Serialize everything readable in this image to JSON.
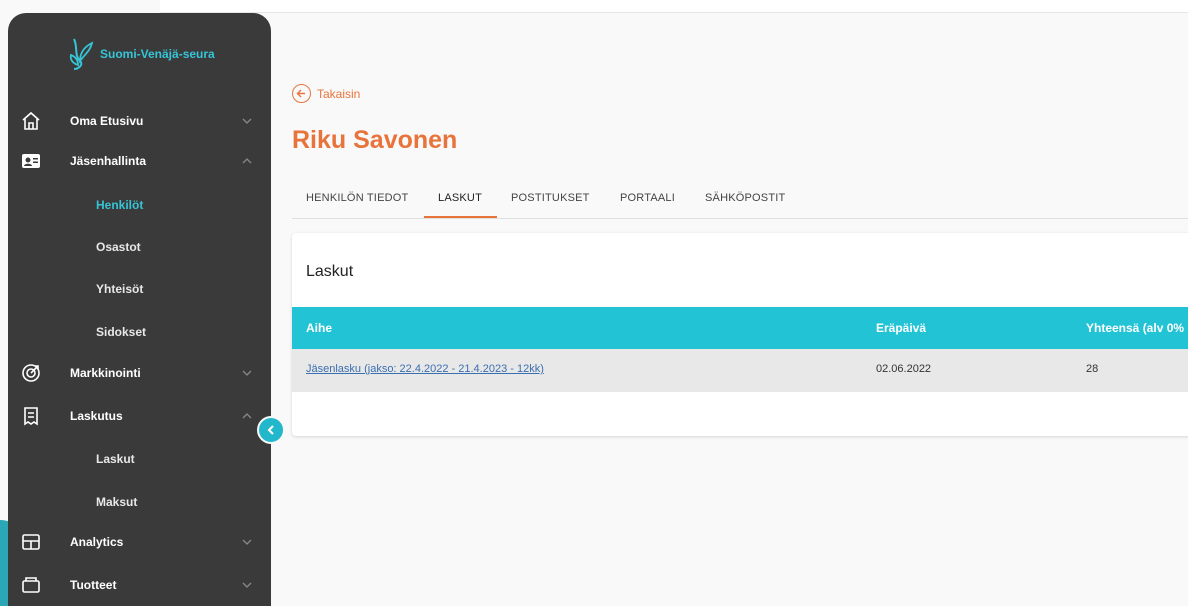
{
  "brand": {
    "name": "Suomi-Venäjä-seura"
  },
  "sidebar": {
    "items": [
      {
        "label": "Oma Etusivu",
        "icon": "home-icon",
        "expanded": false
      },
      {
        "label": "Jäsenhallinta",
        "icon": "id-card-icon",
        "expanded": true,
        "children": [
          {
            "label": "Henkilöt",
            "active": true
          },
          {
            "label": "Osastot"
          },
          {
            "label": "Yhteisöt"
          },
          {
            "label": "Sidokset"
          }
        ]
      },
      {
        "label": "Markkinointi",
        "icon": "target-icon",
        "expanded": false
      },
      {
        "label": "Laskutus",
        "icon": "invoice-icon",
        "expanded": true,
        "children": [
          {
            "label": "Laskut"
          },
          {
            "label": "Maksut"
          }
        ]
      },
      {
        "label": "Analytics",
        "icon": "table-icon",
        "expanded": false
      },
      {
        "label": "Tuotteet",
        "icon": "box-icon",
        "expanded": false
      }
    ]
  },
  "header": {
    "back_label": "Takaisin",
    "title": "Riku Savonen"
  },
  "tabs": [
    {
      "label": "HENKILÖN TIEDOT"
    },
    {
      "label": "LASKUT",
      "active": true
    },
    {
      "label": "POSTITUKSET"
    },
    {
      "label": "PORTAALI"
    },
    {
      "label": "SÄHKÖPOSTIT"
    }
  ],
  "invoices": {
    "title": "Laskut",
    "columns": [
      "Aihe",
      "Eräpäivä",
      "Yhteensä (alv 0%"
    ],
    "rows": [
      {
        "subject": "Jäsenlasku (jakso: 22.4.2022 - 21.4.2023 - 12kk)",
        "due": "02.06.2022",
        "total": "28"
      }
    ]
  },
  "colors": {
    "accent": "#e8743b",
    "teal": "#23c3d6",
    "sidebar_bg": "#3a3a3a"
  }
}
